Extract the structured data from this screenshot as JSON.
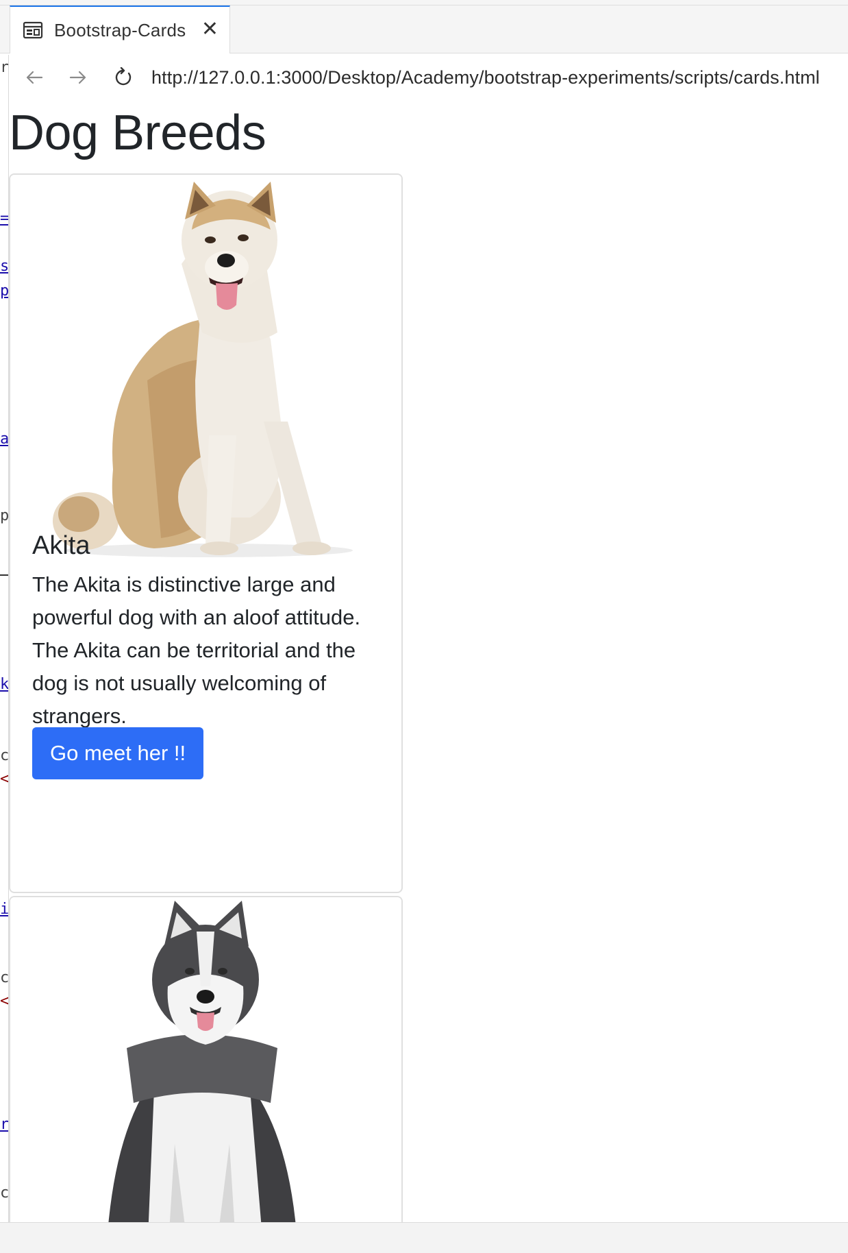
{
  "browser": {
    "tab_title": "Bootstrap-Cards",
    "url": "http://127.0.0.1:3000/Desktop/Academy/bootstrap-experiments/scripts/cards.html",
    "accent_color": "#1a73e8"
  },
  "editor_fragments": [
    "r",
    "=",
    "s",
    "p",
    "a",
    "p",
    "k",
    "c",
    "<",
    "i",
    "c",
    "<",
    "r",
    "c"
  ],
  "page": {
    "title": "Dog Breeds",
    "cards": [
      {
        "image": "akita-photo",
        "title": "Akita",
        "text": "The Akita is distinctive large and powerful dog with an aloof attitude. The Akita can be territorial and the dog is not usually welcoming of strangers.",
        "button_label": "Go meet her !!",
        "button_color": "#2d6df6"
      },
      {
        "image": "alaskan-malamute-photo"
      }
    ]
  }
}
